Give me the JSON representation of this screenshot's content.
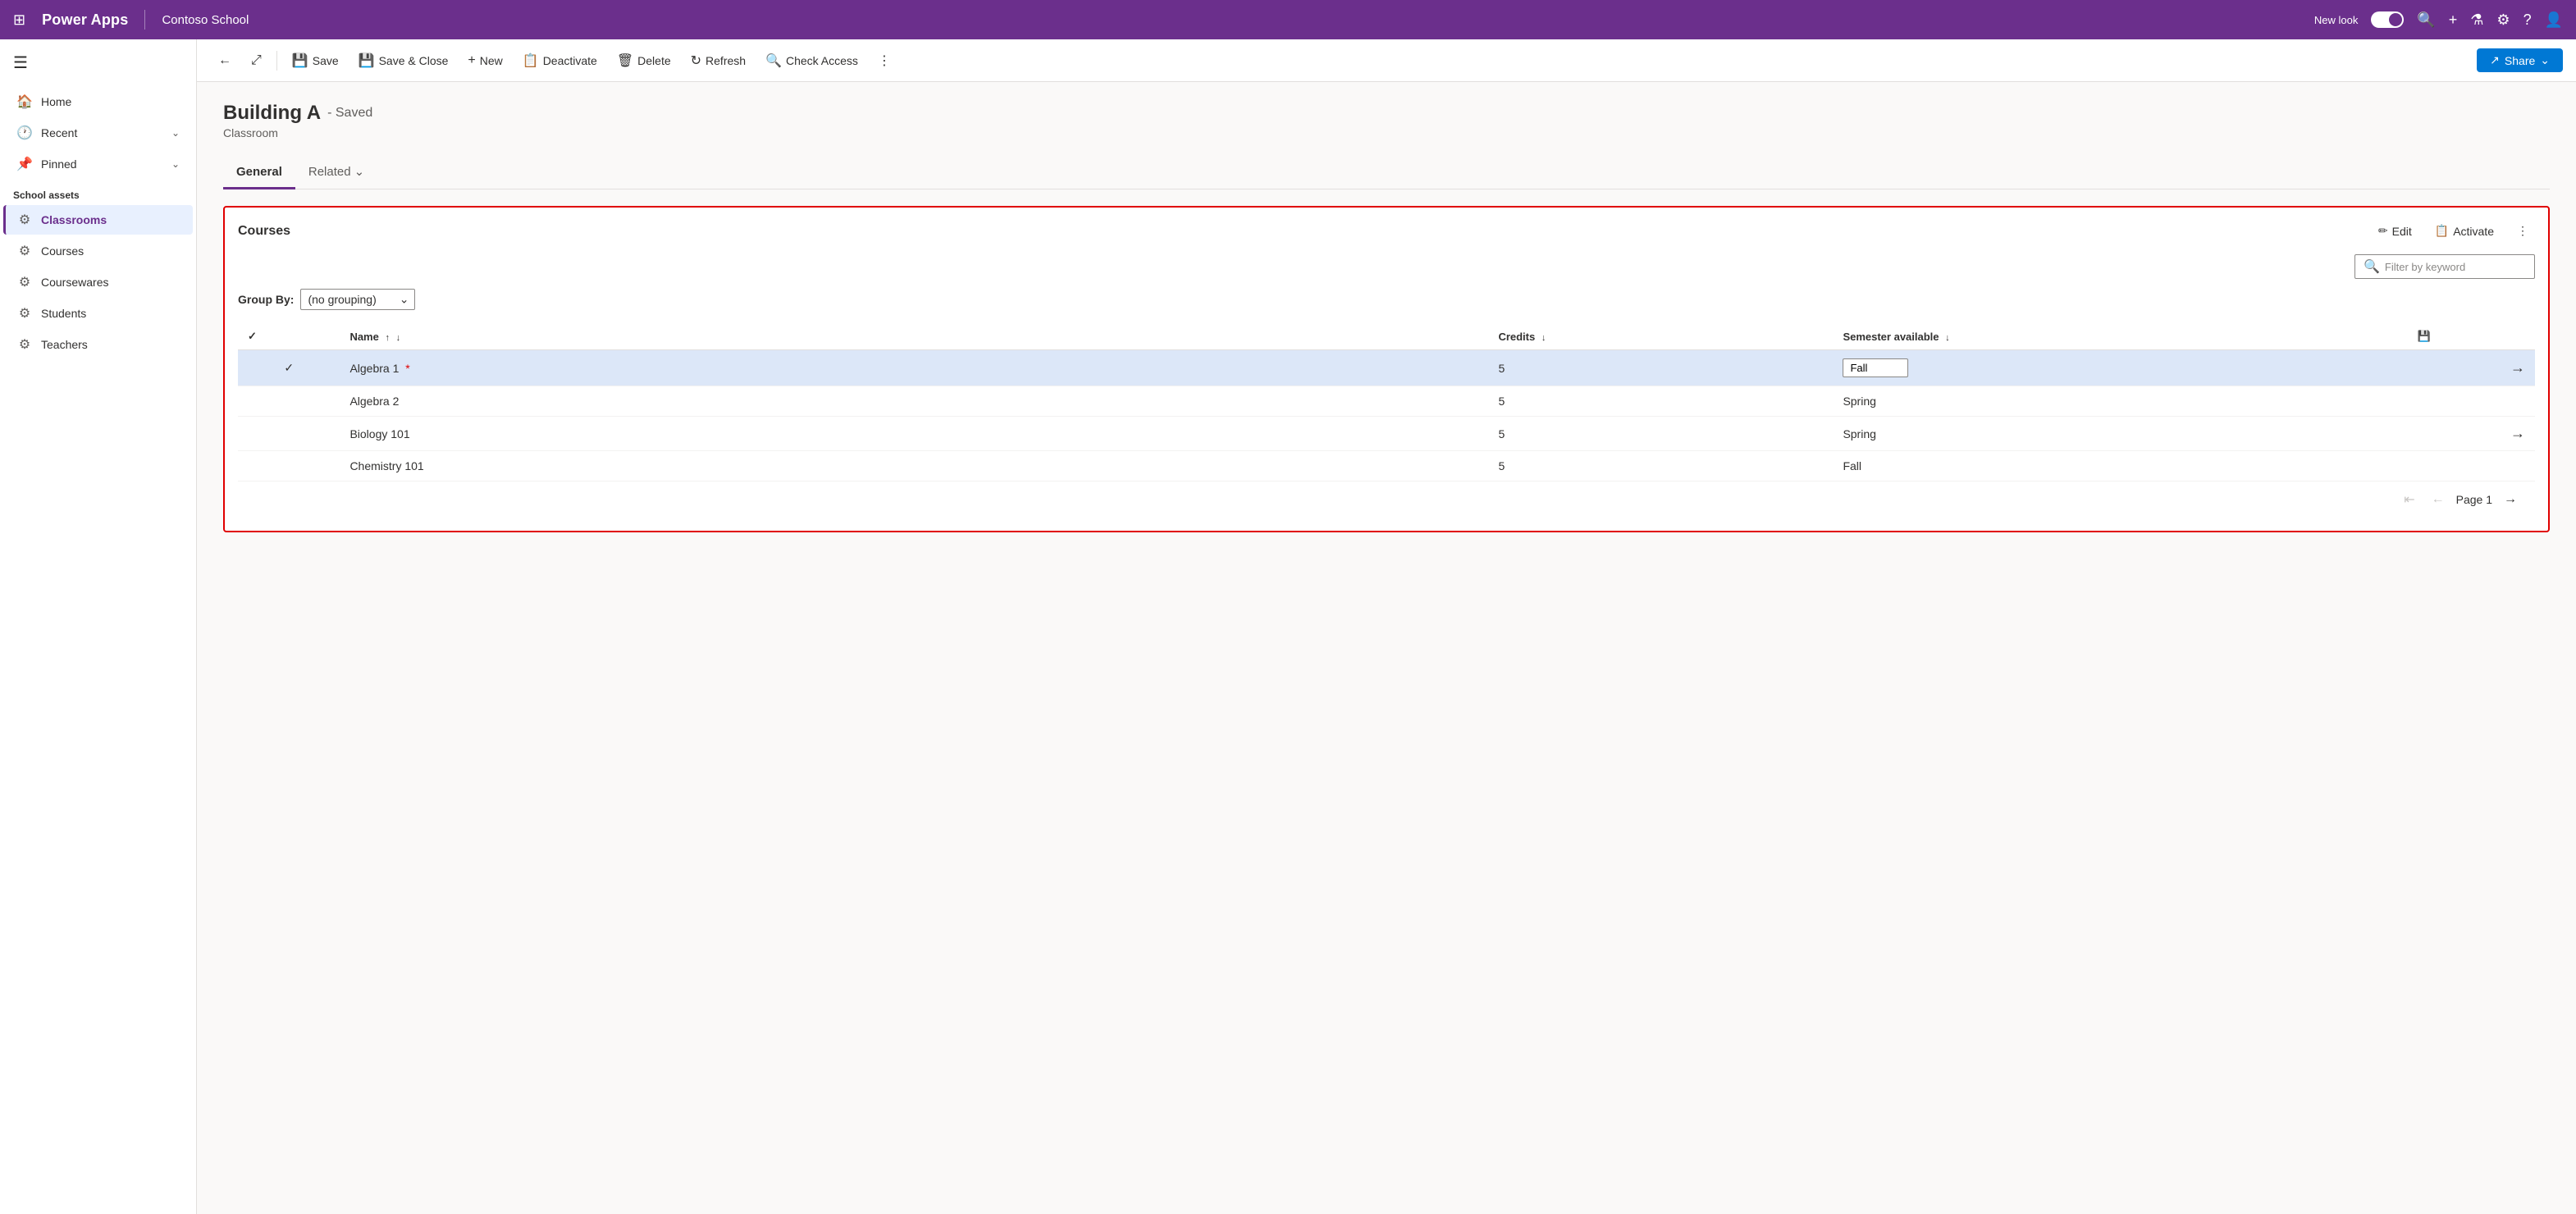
{
  "topNav": {
    "appName": "Power Apps",
    "appContext": "Contoso School",
    "newLookLabel": "New look",
    "icons": {
      "waffle": "⊞",
      "search": "🔍",
      "plus": "+",
      "filter": "⚗",
      "settings": "⚙",
      "help": "?",
      "user": "👤"
    }
  },
  "sidebar": {
    "hamburgerIcon": "☰",
    "navItems": [
      {
        "id": "home",
        "label": "Home",
        "icon": "🏠",
        "hasChevron": false
      },
      {
        "id": "recent",
        "label": "Recent",
        "icon": "🕐",
        "hasChevron": true
      },
      {
        "id": "pinned",
        "label": "Pinned",
        "icon": "📌",
        "hasChevron": true
      }
    ],
    "sectionTitle": "School assets",
    "sectionItems": [
      {
        "id": "classrooms",
        "label": "Classrooms",
        "icon": "⚙",
        "active": true
      },
      {
        "id": "courses",
        "label": "Courses",
        "icon": "⚙",
        "active": false
      },
      {
        "id": "coursewares",
        "label": "Coursewares",
        "icon": "⚙",
        "active": false
      },
      {
        "id": "students",
        "label": "Students",
        "icon": "⚙",
        "active": false
      },
      {
        "id": "teachers",
        "label": "Teachers",
        "icon": "⚙",
        "active": false
      }
    ]
  },
  "toolbar": {
    "backIcon": "←",
    "openIcon": "⤢",
    "saveLabel": "Save",
    "saveIcon": "💾",
    "saveCloseLabel": "Save & Close",
    "saveCloseIcon": "💾",
    "newLabel": "New",
    "newIcon": "+",
    "deactivateLabel": "Deactivate",
    "deactivateIcon": "📋",
    "deleteLabel": "Delete",
    "deleteIcon": "🗑",
    "refreshLabel": "Refresh",
    "refreshIcon": "↻",
    "checkAccessLabel": "Check Access",
    "checkAccessIcon": "🔍",
    "moreIcon": "⋮",
    "shareLabel": "Share",
    "shareIcon": "↗"
  },
  "record": {
    "title": "Building A",
    "savedBadge": "- Saved",
    "type": "Classroom"
  },
  "tabs": [
    {
      "id": "general",
      "label": "General",
      "active": true
    },
    {
      "id": "related",
      "label": "Related",
      "active": false,
      "hasChevron": true
    }
  ],
  "coursesSection": {
    "title": "Courses",
    "editIcon": "✏",
    "editLabel": "Edit",
    "activateIcon": "📋",
    "activateLabel": "Activate",
    "moreIcon": "⋮",
    "filterPlaceholder": "Filter by keyword",
    "filterSearchIcon": "🔍",
    "groupByLabel": "Group By:",
    "groupByOptions": [
      "(no grouping)"
    ],
    "groupBySelected": "(no grouping)",
    "columns": [
      {
        "id": "name",
        "label": "Name",
        "sortDir": "asc"
      },
      {
        "id": "credits",
        "label": "Credits",
        "sortDir": "desc"
      },
      {
        "id": "semester",
        "label": "Semester available",
        "sortDir": null
      }
    ],
    "rows": [
      {
        "id": 1,
        "name": "Algebra 1",
        "credits": 5,
        "semester": "Fall",
        "selected": true,
        "hasRequired": true,
        "semesterEditable": true
      },
      {
        "id": 2,
        "name": "Algebra 2",
        "credits": 5,
        "semester": "Spring",
        "selected": false,
        "hasRequired": false,
        "semesterEditable": false
      },
      {
        "id": 3,
        "name": "Biology 101",
        "credits": 5,
        "semester": "Spring",
        "selected": false,
        "hasRequired": false,
        "semesterEditable": false
      },
      {
        "id": 4,
        "name": "Chemistry 101",
        "credits": 5,
        "semester": "Fall",
        "selected": false,
        "hasRequired": false,
        "semesterEditable": false
      }
    ],
    "saveIconLabel": "💾",
    "pagination": {
      "pageLabel": "Page 1",
      "firstIcon": "⇤",
      "prevIcon": "←",
      "nextIcon": "→"
    }
  }
}
